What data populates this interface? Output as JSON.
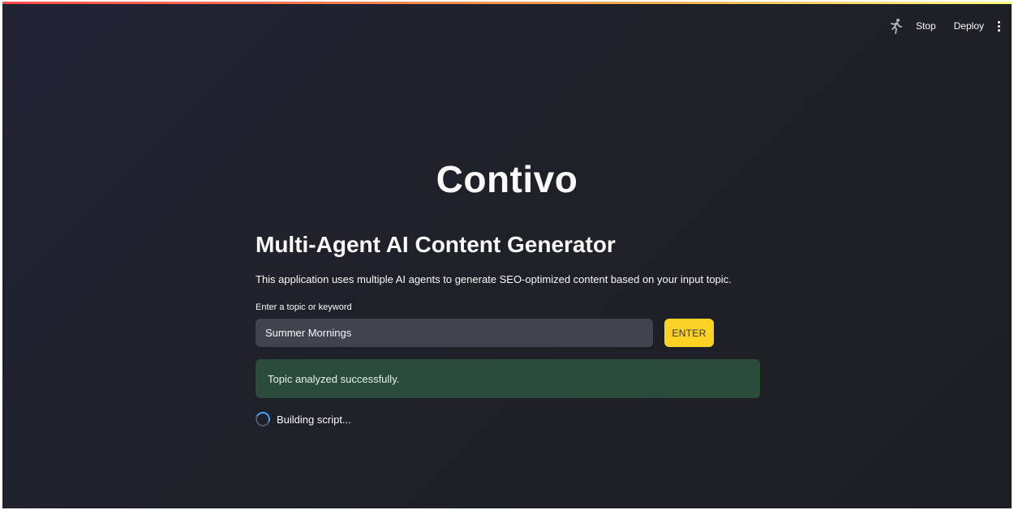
{
  "header": {
    "running_icon": "running-man-icon",
    "stop_label": "Stop",
    "deploy_label": "Deploy",
    "menu_icon": "vertical-ellipsis-icon"
  },
  "app": {
    "title": "Contivo",
    "subtitle": "Multi-Agent AI Content Generator",
    "description": "This application uses multiple AI agents to generate SEO-optimized content based on your input topic."
  },
  "form": {
    "label": "Enter a topic or keyword",
    "input_value": "Summer Mornings",
    "submit_label": "ENTER"
  },
  "alert": {
    "message": "Topic analyzed successfully."
  },
  "status": {
    "text": "Building script..."
  },
  "colors": {
    "accent_button": "#fcd224",
    "success_background": "#2b4b3b",
    "spinner": "#4aa2f5",
    "top_decoration_start": "#ff4b4b",
    "top_decoration_end": "#fffd80"
  }
}
